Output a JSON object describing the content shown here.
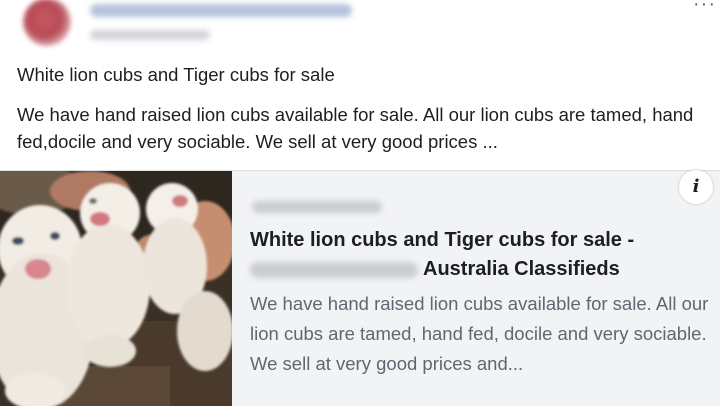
{
  "post": {
    "title": "White lion cubs and Tiger cubs for sale",
    "body": "We have hand raised lion cubs available for sale. All our lion cubs are tamed, hand fed,docile and very sociable. We sell at very good prices ..."
  },
  "header": {
    "more_label": "···"
  },
  "link_card": {
    "info_label": "i",
    "title_line1": "White lion cubs and Tiger cubs for sale -",
    "title_line2": "Australia Classifieds",
    "description": "We have hand raised lion cubs available for sale. All our lion cubs are tamed, hand fed, docile and very sociable. We sell at very good prices and..."
  },
  "colors": {
    "card_background": "#f2f3f5",
    "secondary_text": "#606770",
    "primary_text": "#1c1e21"
  }
}
